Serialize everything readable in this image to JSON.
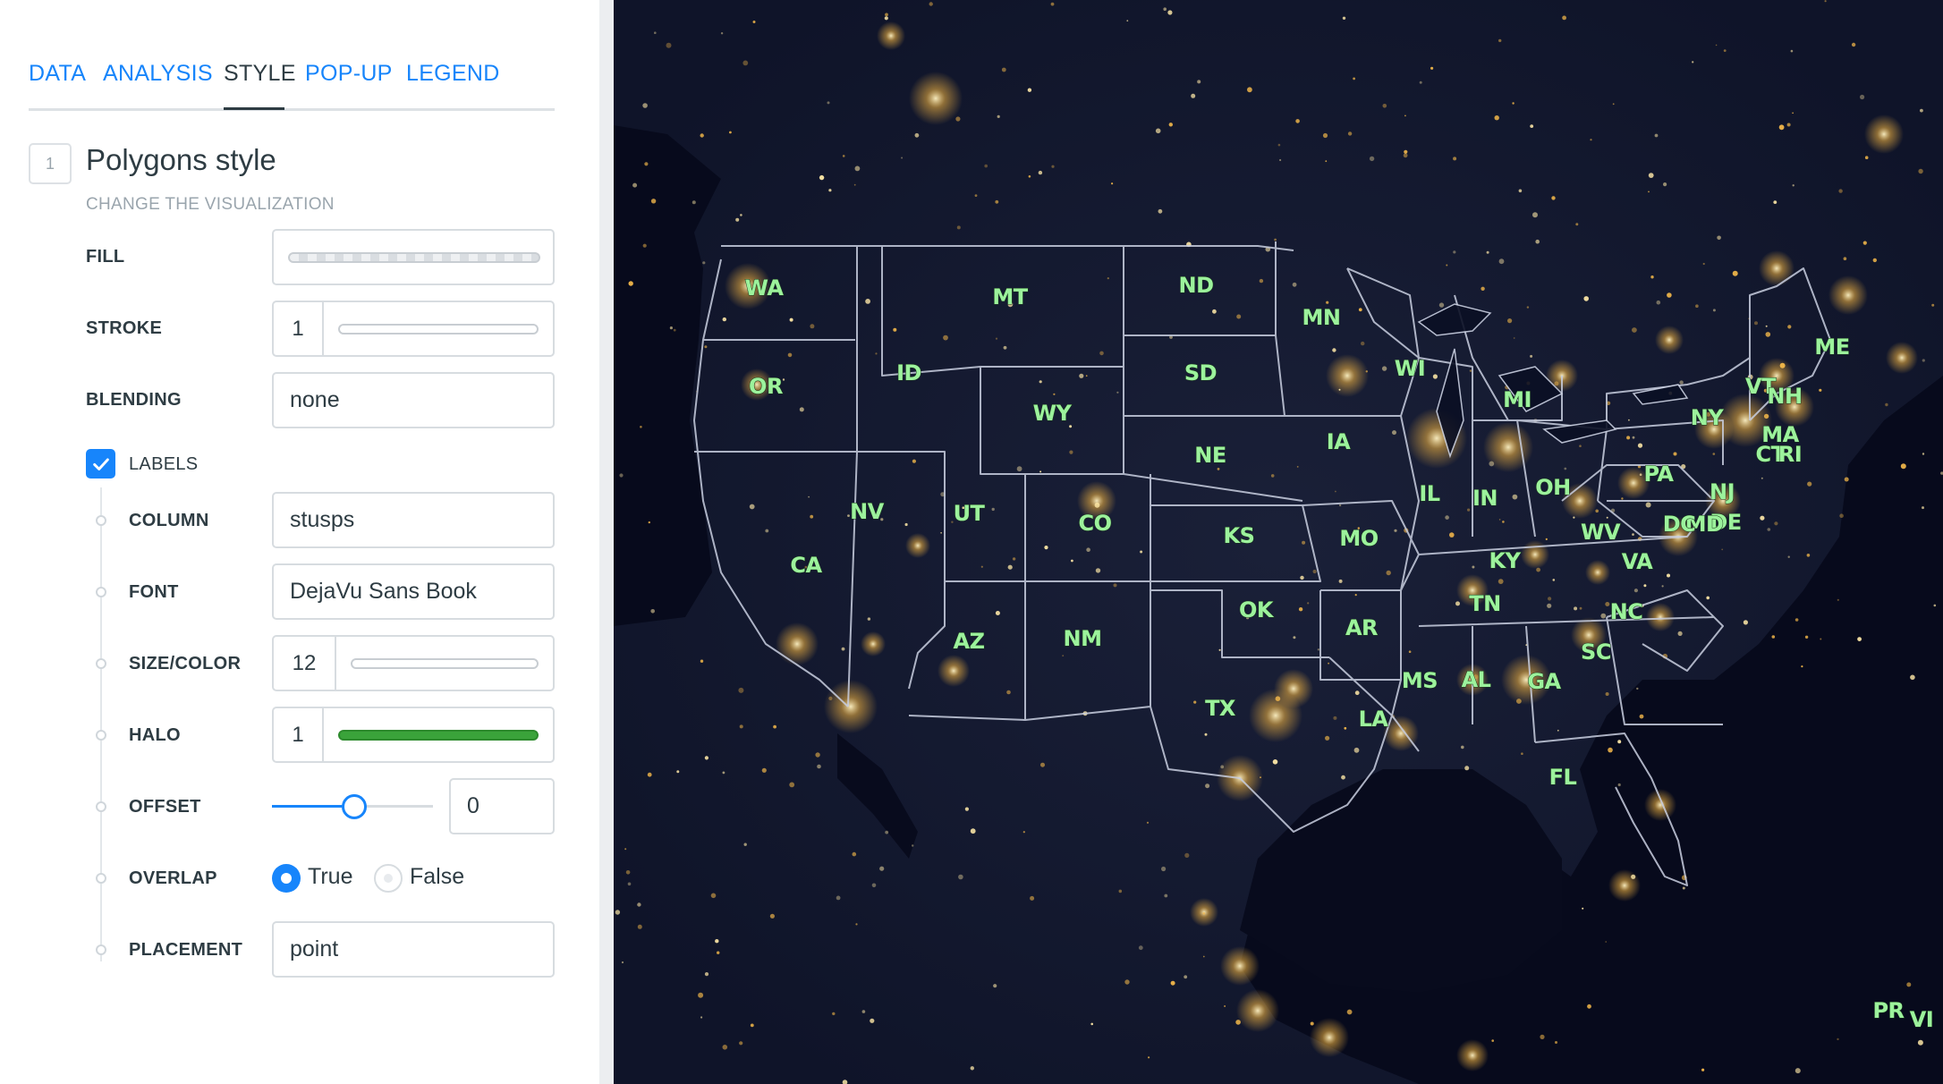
{
  "tabs": [
    {
      "label": "DATA",
      "active": false
    },
    {
      "label": "ANALYSIS",
      "active": false
    },
    {
      "label": "STYLE",
      "active": true
    },
    {
      "label": "POP-UP",
      "active": false
    },
    {
      "label": "LEGEND",
      "active": false
    }
  ],
  "section": {
    "step": "1",
    "title": "Polygons style",
    "subtitle": "CHANGE THE VISUALIZATION"
  },
  "style": {
    "fill_label": "FILL",
    "stroke_label": "STROKE",
    "stroke_value": "1",
    "blending_label": "BLENDING",
    "blending_value": "none"
  },
  "labels": {
    "toggle_label": "LABELS",
    "checked": true,
    "column_label": "COLUMN",
    "column_value": "stusps",
    "font_label": "FONT",
    "font_value": "DejaVu Sans Book",
    "size_color_label": "SIZE/COLOR",
    "size_value": "12",
    "halo_label": "HALO",
    "halo_value": "1",
    "halo_color": "#3aa33a",
    "offset_label": "OFFSET",
    "offset_value": "0",
    "overlap_label": "OVERLAP",
    "overlap_true": "True",
    "overlap_false": "False",
    "overlap_selected": "True",
    "placement_label": "PLACEMENT",
    "placement_value": "point"
  },
  "colors": {
    "accent": "#1785fb",
    "map_background": "#0a0d22",
    "label_fill": "#9cf29c",
    "state_border": "#c9cfe0"
  },
  "map": {
    "state_labels": [
      "WA",
      "OR",
      "CA",
      "ID",
      "NV",
      "MT",
      "WY",
      "UT",
      "AZ",
      "CO",
      "NM",
      "ND",
      "SD",
      "NE",
      "KS",
      "OK",
      "TX",
      "MN",
      "IA",
      "MO",
      "AR",
      "LA",
      "WI",
      "IL",
      "MI",
      "IN",
      "OH",
      "KY",
      "TN",
      "MS",
      "AL",
      "GA",
      "FL",
      "SC",
      "NC",
      "VA",
      "WV",
      "PA",
      "NY",
      "VT",
      "NH",
      "ME",
      "MA",
      "CT",
      "RI",
      "NJ",
      "DE",
      "MD",
      "DC",
      "PR",
      "VI"
    ]
  }
}
